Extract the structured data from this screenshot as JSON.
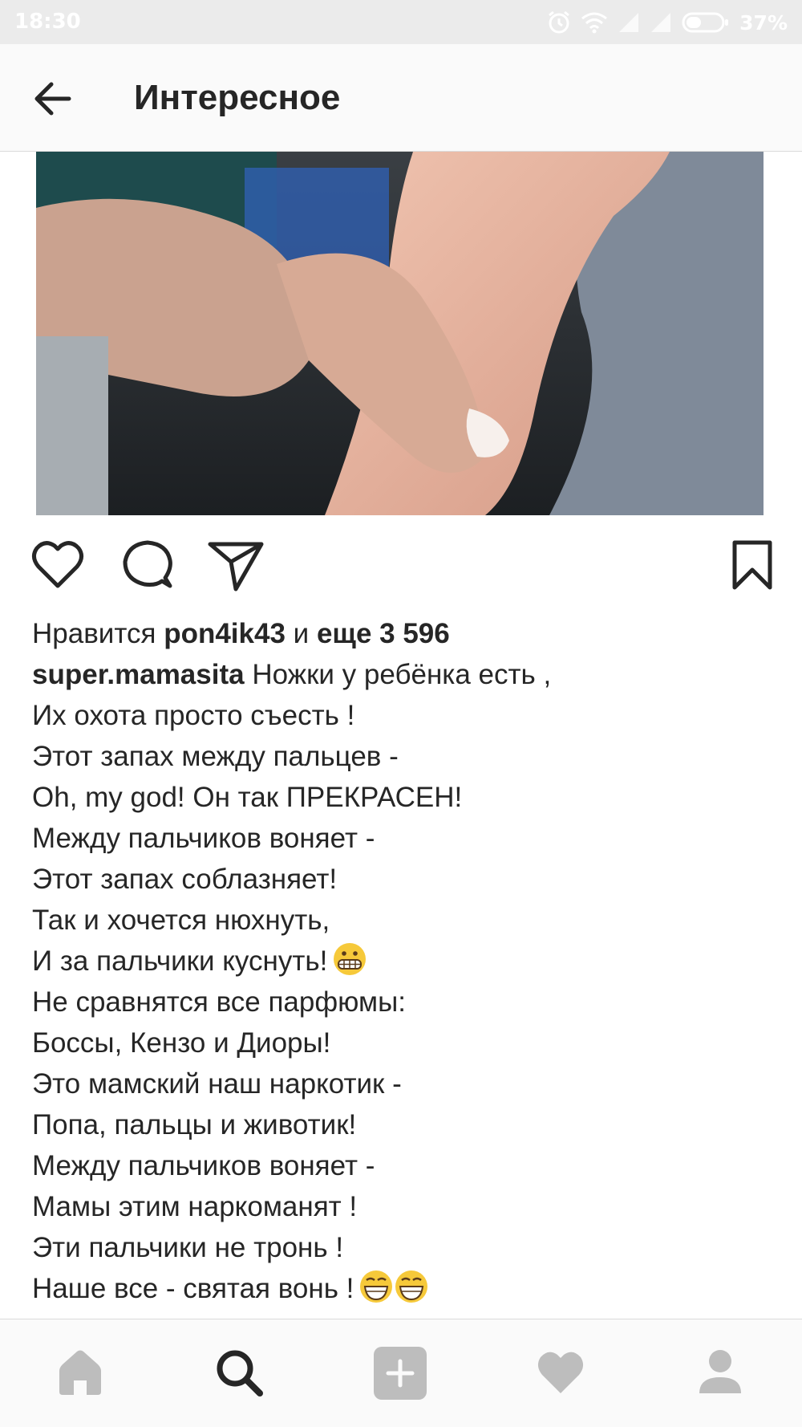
{
  "status_bar": {
    "time": "18:30",
    "battery_percent": "37%",
    "icons": [
      "alarm-icon",
      "wifi-icon",
      "signal-icon",
      "signal-icon",
      "battery-icon"
    ]
  },
  "header": {
    "back_icon": "arrow-left-icon",
    "title": "Интересное"
  },
  "post": {
    "actions": [
      "heart-icon",
      "comment-icon",
      "send-icon",
      "bookmark-icon"
    ],
    "likes": {
      "prefix": "Нравится",
      "user": "pon4ik43",
      "conjunction": "и",
      "more": "еще 3 596"
    },
    "author": "super.mamasita",
    "caption_first": "Ножки у ребёнка есть ,",
    "caption_lines": [
      "Их охота просто съесть !",
      "Этот запах между пальцев -",
      "Oh, my god! Он так ПРЕКРАСЕН!",
      "Между пальчиков воняет -",
      "Этот запах соблазняет!",
      "Так и хочется нюхнуть,",
      "И за пальчики куснуть!",
      "Не сравнятся все парфюмы:",
      "Боссы, Кензо и Диоры!",
      "Это мамский наш наркотик -",
      "Попа, пальцы и животик!",
      "Между пальчиков воняет -",
      "Мамы этим наркоманят !",
      "Эти пальчики не тронь !",
      "Наше все - святая вонь !"
    ]
  },
  "bottom_nav": [
    "home-icon",
    "search-icon",
    "add-post-icon",
    "heart-icon",
    "profile-icon"
  ]
}
